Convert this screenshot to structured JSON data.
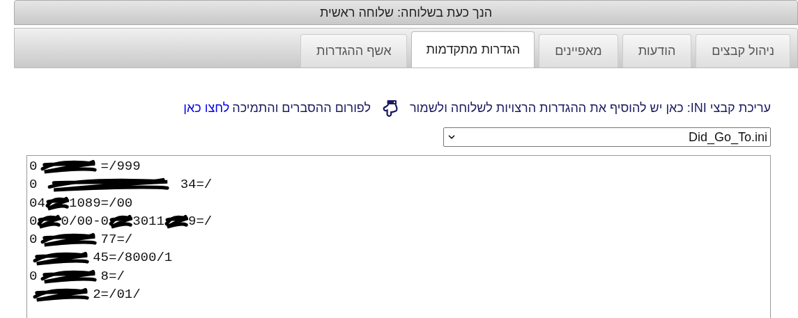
{
  "title": "הנך כעת בשלוחה: שלוחה ראשית",
  "tabs": [
    {
      "label": "ניהול קבצים",
      "selected": false
    },
    {
      "label": "הודעות",
      "selected": false
    },
    {
      "label": "מאפיינים",
      "selected": false
    },
    {
      "label": "הגדרות מתקדמות",
      "selected": true
    },
    {
      "label": "אשף ההגדרות",
      "selected": false
    }
  ],
  "notice": {
    "text": "עריכת קבצי INI: כאן יש להוסיף את ההגדרות הרצויות לשלוחה ולשמור",
    "forum_text": "לפורום ההסברים והתמיכה",
    "link": "לחצו כאן"
  },
  "file_select": {
    "value": "Did_Go_To.ini"
  },
  "editor": {
    "lines": [
      {
        "wide": false,
        "narrow": false,
        "lead": "0",
        "tail": "=/999"
      },
      {
        "wide": true,
        "narrow": false,
        "lead": "0",
        "tail": "34=/"
      },
      {
        "wide": false,
        "narrow": true,
        "lead": "04",
        "tail": "1089=/00"
      },
      {
        "wide": false,
        "narrow": true,
        "lead": "0",
        "mid": "0/00-0",
        "mid_2": "3011",
        "tail": "9=/"
      },
      {
        "wide": false,
        "narrow": false,
        "lead": "0",
        "tail": "77=/"
      },
      {
        "wide": false,
        "narrow": false,
        "tail": "45=/8000/1"
      },
      {
        "wide": false,
        "narrow": false,
        "lead": "0",
        "tail": "8=/"
      },
      {
        "wide": false,
        "narrow": false,
        "tail": "2=/01/"
      }
    ]
  }
}
